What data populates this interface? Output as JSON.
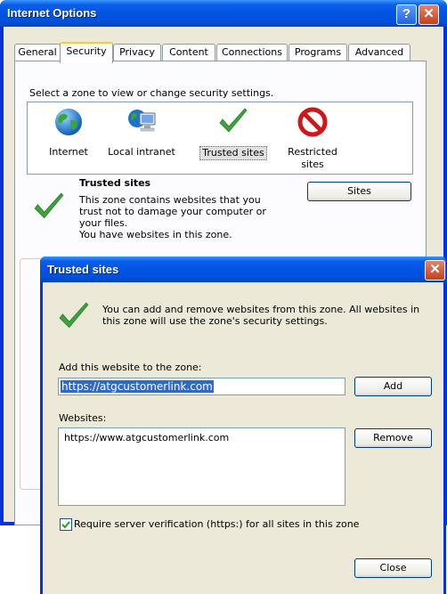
{
  "main_window": {
    "title": "Internet Options",
    "help_glyph": "?",
    "close_glyph": "✕",
    "tabs": [
      {
        "label": "General"
      },
      {
        "label": "Security"
      },
      {
        "label": "Privacy"
      },
      {
        "label": "Content"
      },
      {
        "label": "Connections"
      },
      {
        "label": "Programs"
      },
      {
        "label": "Advanced"
      }
    ],
    "active_tab": "Security",
    "instruction": "Select a zone to view or change security settings.",
    "zones": [
      {
        "label": "Internet",
        "icon": "globe-icon"
      },
      {
        "label": "Local intranet",
        "icon": "computer-globe-icon"
      },
      {
        "label": "Trusted sites",
        "icon": "checkmark-icon"
      },
      {
        "label": "Restricted sites",
        "icon": "restricted-icon"
      }
    ],
    "selected_zone": "Trusted sites",
    "zone_heading": "Trusted sites",
    "zone_description": [
      "This zone contains websites that you",
      "trust not to damage your computer or",
      "your files.",
      "You have websites in this zone."
    ],
    "sites_button": "Sites"
  },
  "dialog": {
    "title": "Trusted sites",
    "close_glyph": "✕",
    "info_text": [
      "You can add and remove websites from this zone. All websites in",
      "this zone will use the zone's security settings."
    ],
    "add_label": "Add this website to the zone:",
    "add_value": "https://atgcustomerlink.com",
    "add_button": "Add",
    "websites_label": "Websites:",
    "websites": [
      "https://www.atgcustomerlink.com"
    ],
    "remove_button": "Remove",
    "require_verification_label": "Require server verification (https:) for all sites in this zone",
    "require_verification_checked": true,
    "close_button": "Close"
  },
  "colors": {
    "title_bar": "#0054e3",
    "dialog_face": "#ece9d8",
    "selection": "#316ac5",
    "close_red": "#c3401b",
    "check_green": "#3ea33e",
    "tab_highlight": "#ffc83c"
  }
}
